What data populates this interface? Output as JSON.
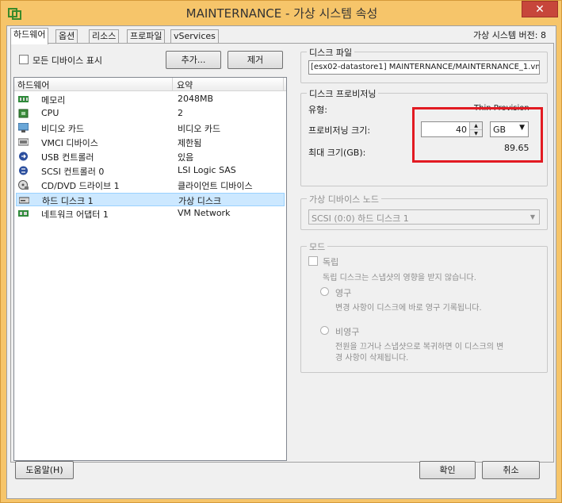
{
  "window": {
    "title": "MAINTERNANCE - 가상 시스템 속성",
    "close_glyph": "✕"
  },
  "tabs": [
    {
      "label": "하드웨어"
    },
    {
      "label": "옵션"
    },
    {
      "label": "리소스"
    },
    {
      "label": "프로파일"
    },
    {
      "label": "vServices"
    }
  ],
  "version_label": "가상 시스템 버전: 8",
  "show_all_devices": {
    "label": "모든 디바이스 표시",
    "checked": false
  },
  "add_button": "추가...",
  "remove_button": "제거",
  "hardware_list": {
    "col_hardware": "하드웨어",
    "col_summary": "요약",
    "items": [
      {
        "name": "메모리",
        "summary": "2048MB",
        "icon": "memory-icon"
      },
      {
        "name": "CPU",
        "summary": "2",
        "icon": "cpu-icon"
      },
      {
        "name": "비디오 카드",
        "summary": "비디오 카드",
        "icon": "monitor-icon"
      },
      {
        "name": "VMCI 디바이스",
        "summary": "제한됨",
        "icon": "vmci-icon"
      },
      {
        "name": "USB 컨트롤러",
        "summary": "있음",
        "icon": "usb-icon"
      },
      {
        "name": "SCSI 컨트롤러 0",
        "summary": "LSI Logic SAS",
        "icon": "scsi-icon"
      },
      {
        "name": "CD/DVD 드라이브 1",
        "summary": "클라이언트 디바이스",
        "icon": "cdrom-icon"
      },
      {
        "name": "하드 디스크 1",
        "summary": "가상 디스크",
        "icon": "harddisk-icon",
        "selected": true
      },
      {
        "name": "네트워크 어댑터 1",
        "summary": "VM Network",
        "icon": "network-icon"
      }
    ]
  },
  "disk_file": {
    "group_title": "디스크 파일",
    "value": "[esx02-datastore1] MAINTERNANCE/MAINTERNANCE_1.vmdk"
  },
  "disk_provisioning": {
    "group_title": "디스크 프로비저닝",
    "type_label": "유형:",
    "type_value": "Thin Provision",
    "size_label": "프로비저닝 크기:",
    "size_value": "40",
    "size_unit": "GB",
    "max_label": "최대 크기(GB):",
    "max_value": "89.65"
  },
  "virtual_device_node": {
    "group_title": "가상 디바이스 노드",
    "value": "SCSI (0:0) 하드 디스크 1"
  },
  "mode": {
    "group_title": "모드",
    "independent_label": "독립",
    "independent_desc": "독립 디스크는 스냅샷의 영향을 받지 않습니다.",
    "persistent_label": "영구",
    "persistent_desc": "변경 사항이 디스크에 바로 영구 기록됩니다.",
    "nonpersistent_label": "비영구",
    "nonpersistent_desc_1": "전원을 끄거나 스냅샷으로 복귀하면 이 디스크의 변",
    "nonpersistent_desc_2": "경 사항이 삭제됩니다."
  },
  "footer": {
    "help_button": "도움말(H)",
    "ok_button": "확인",
    "cancel_button": "취소"
  },
  "colors": {
    "title_bar": "#f6c56a",
    "close_button": "#c7463b",
    "selection": "#cce8ff",
    "annotation_highlight": "#e21a22"
  }
}
